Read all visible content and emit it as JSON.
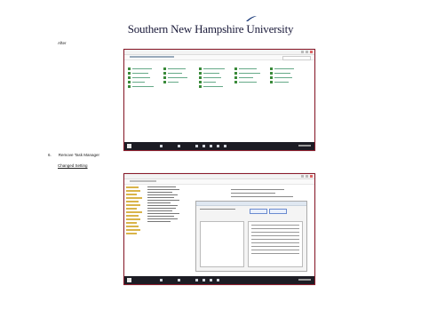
{
  "header": {
    "university_name": "Southern New Hampshire University"
  },
  "section_after": {
    "label": "After"
  },
  "list_item": {
    "number": "6.",
    "text": "Remove Task Manager"
  },
  "changed_setting": {
    "label": "Changed Setting"
  },
  "colors": {
    "logo_text": "#1a1a3a",
    "screenshot_border": "#8a1a2a",
    "taskbar": "#1c1c24"
  }
}
